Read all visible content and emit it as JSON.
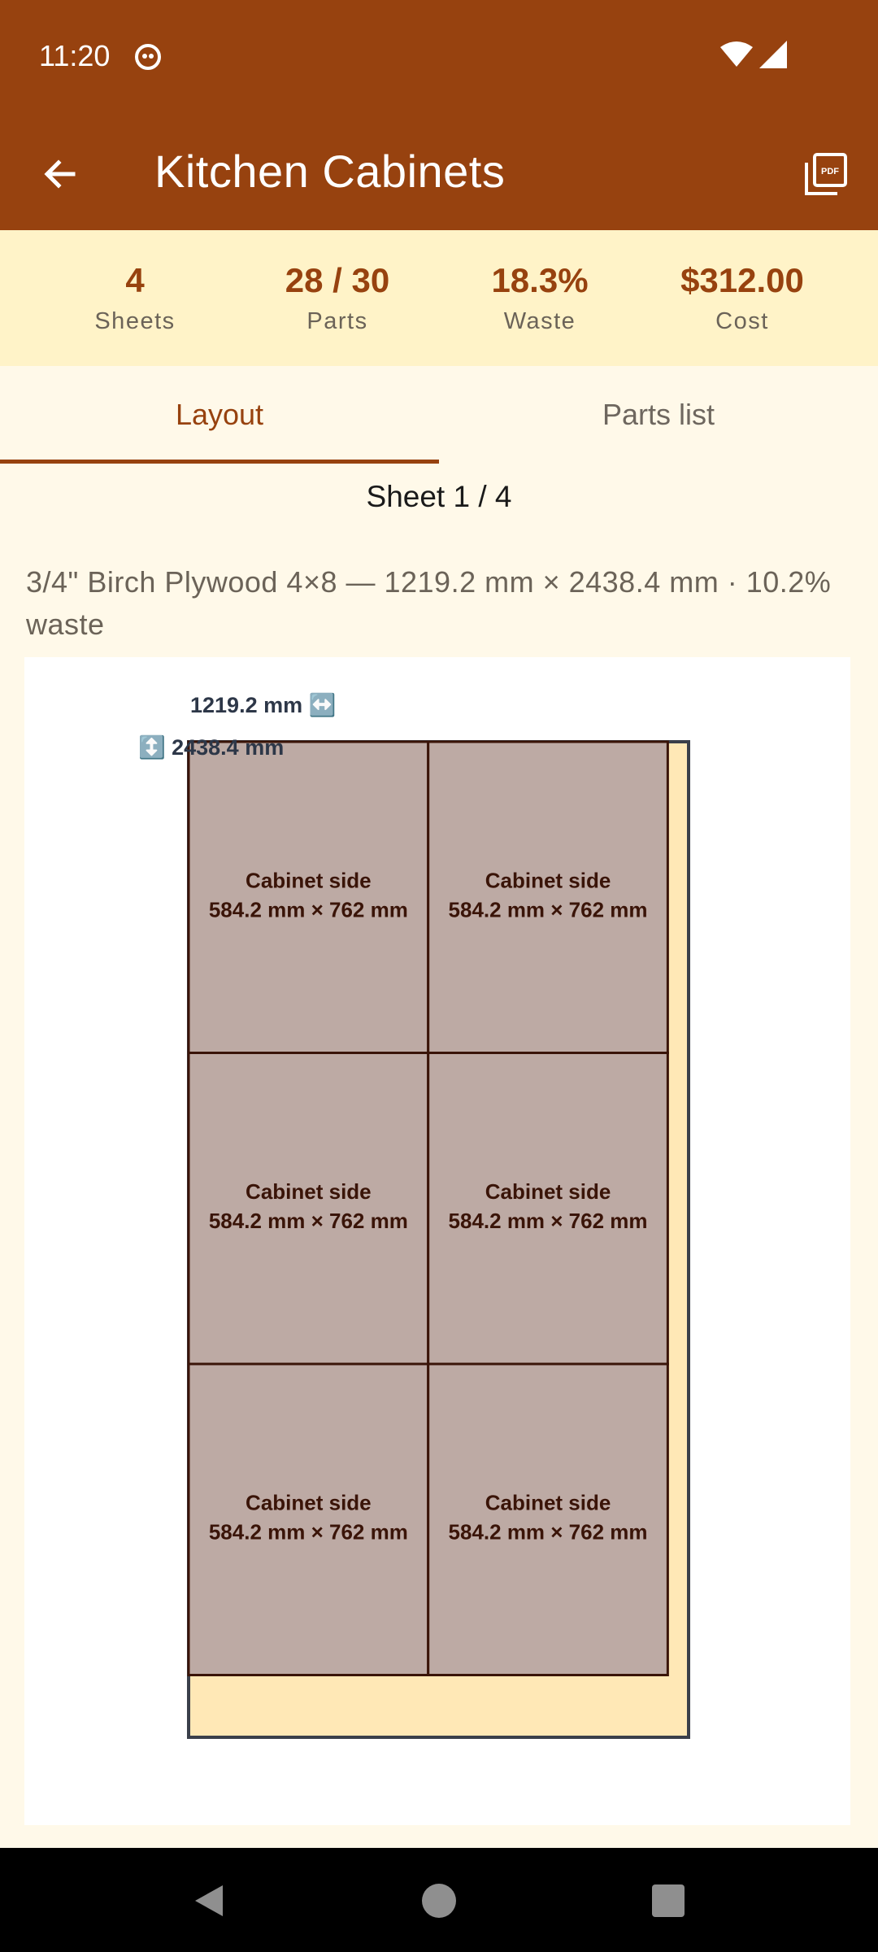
{
  "status_bar": {
    "time": "11:20"
  },
  "app_bar": {
    "title": "Kitchen Cabinets",
    "back_icon": "arrow-left-icon",
    "action_icon": "pdf-icon"
  },
  "summary": {
    "stats": [
      {
        "value": "4",
        "label": "Sheets"
      },
      {
        "value": "28 / 30",
        "label": "Parts"
      },
      {
        "value": "18.3%",
        "label": "Waste"
      },
      {
        "value": "$312.00",
        "label": "Cost"
      }
    ]
  },
  "tabs": [
    {
      "label": "Layout",
      "active": true
    },
    {
      "label": "Parts list",
      "active": false
    }
  ],
  "sheet": {
    "title": "Sheet 1 / 4",
    "description": "3/4\" Birch Plywood 4×8 — 1219.2 mm × 2438.4 mm  ·  10.2% waste",
    "width_label": "1219.2 mm ↔️",
    "height_label": "↕️ 2438.4 mm",
    "width_mm": 1219.2,
    "height_mm": 2438.4,
    "parts": [
      {
        "name": "Cabinet side",
        "size": "584.2 mm × 762 mm",
        "col": 0,
        "row": 0
      },
      {
        "name": "Cabinet side",
        "size": "584.2 mm × 762 mm",
        "col": 1,
        "row": 0
      },
      {
        "name": "Cabinet side",
        "size": "584.2 mm × 762 mm",
        "col": 0,
        "row": 1
      },
      {
        "name": "Cabinet side",
        "size": "584.2 mm × 762 mm",
        "col": 1,
        "row": 1
      },
      {
        "name": "Cabinet side",
        "size": "584.2 mm × 762 mm",
        "col": 0,
        "row": 2
      },
      {
        "name": "Cabinet side",
        "size": "584.2 mm × 762 mm",
        "col": 1,
        "row": 2
      }
    ],
    "part_width_mm": 584.2,
    "part_height_mm": 762
  },
  "colors": {
    "primary": "#97420F",
    "summary_bg": "#FFF3C8",
    "page_bg": "#FFF9E9",
    "sheet_fill": "#FFE8B6",
    "part_fill": "#BDAAA4",
    "part_border": "#3A1408",
    "part_text": "#3A1408",
    "sheet_border": "#3A3F4A"
  }
}
